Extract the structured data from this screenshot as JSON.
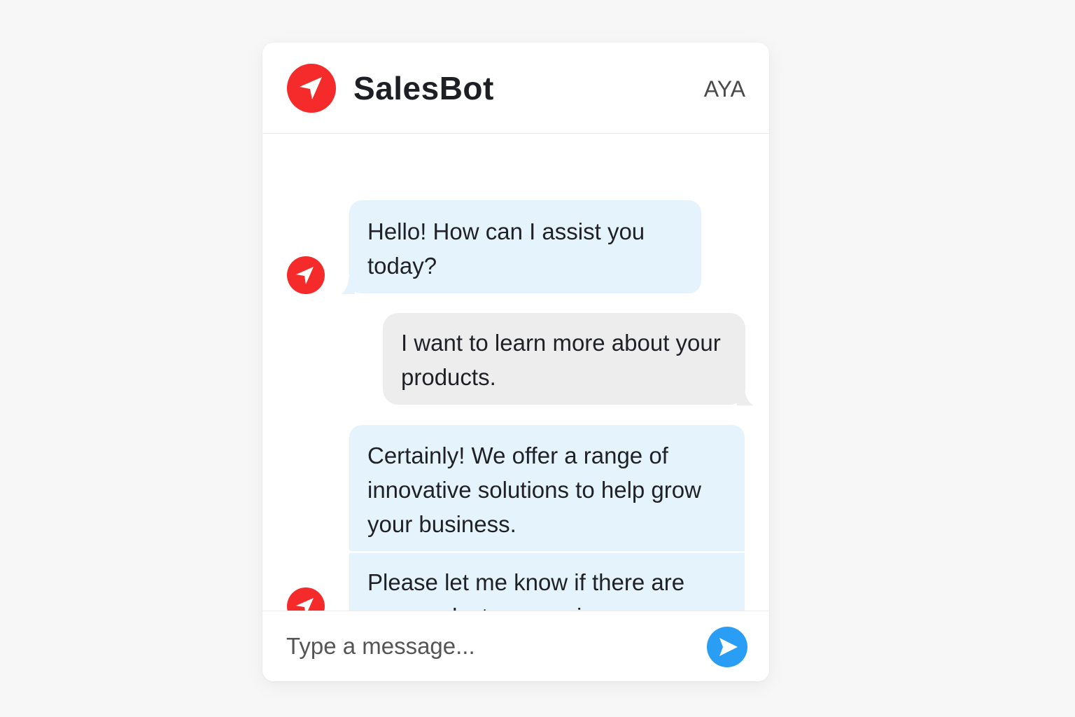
{
  "app": {
    "title": "SalesBot",
    "user_initials": "AYA",
    "brand_color": "#f52a2a",
    "logo_icon": "navigation-arrow-icon"
  },
  "messages": [
    {
      "sender": "bot",
      "text": "Hello! How can I assist you today?"
    },
    {
      "sender": "user",
      "text": "I want to learn more about your products."
    },
    {
      "sender": "bot",
      "text": "Certainly! We offer a range of innovative solutions to help grow your business."
    },
    {
      "sender": "bot",
      "text": "Please let me know if there are any products or services you are interested in."
    }
  ],
  "colors": {
    "bot_bubble": "#e5f3fd",
    "user_bubble": "#ededed",
    "send_button": "#2a9df4"
  },
  "composer": {
    "placeholder": "Type a message...",
    "value": "",
    "send_icon": "send-arrow-icon"
  }
}
